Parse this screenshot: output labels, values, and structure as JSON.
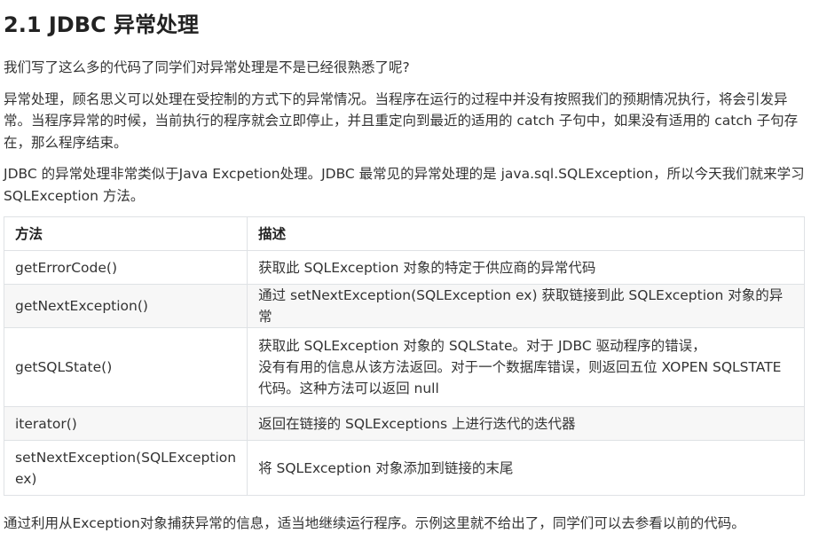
{
  "title": "2.1 JDBC 异常处理",
  "paragraphs": {
    "intro": "我们写了这么多的代码了同学们对异常处理是不是已经很熟悉了呢?",
    "p2": "异常处理，顾名思义可以处理在受控制的方式下的异常情况。当程序在运行的过程中并没有按照我们的预期情况执行，将会引发异常。当程序异常的时候，当前执行的程序就会立即停止，并且重定向到最近的适用的 catch 子句中，如果没有适用的 catch 子句存在，那么程序结束。",
    "p3": "JDBC 的异常处理非常类似于Java Excpetion处理。JDBC 最常见的异常处理的是 java.sql.SQLException，所以今天我们就来学习 SQLException 方法。",
    "closing": "通过利用从Exception对象捕获异常的信息，适当地继续运行程序。示例这里就不给出了，同学们可以去参看以前的代码。"
  },
  "table": {
    "headers": [
      "方法",
      "描述"
    ],
    "rows": [
      {
        "method": "getErrorCode()",
        "description": "获取此 SQLException 对象的特定于供应商的异常代码"
      },
      {
        "method": "getNextException()",
        "description": "通过 setNextException(SQLException ex) 获取链接到此 SQLException 对象的异常"
      },
      {
        "method": "getSQLState()",
        "description_lines": [
          "获取此 SQLException 对象的 SQLState。对于 JDBC 驱动程序的错误，",
          "没有有用的信息从该方法返回。对于一个数据库错误，则返回五位 XOPEN SQLSTATE",
          "代码。这种方法可以返回 null"
        ]
      },
      {
        "method": "iterator()",
        "description": "返回在链接的 SQLExceptions 上进行迭代的迭代器"
      },
      {
        "method_lines": [
          "setNextException(SQLException",
          "ex)"
        ],
        "description": "将 SQLException 对象添加到链接的末尾"
      }
    ]
  }
}
